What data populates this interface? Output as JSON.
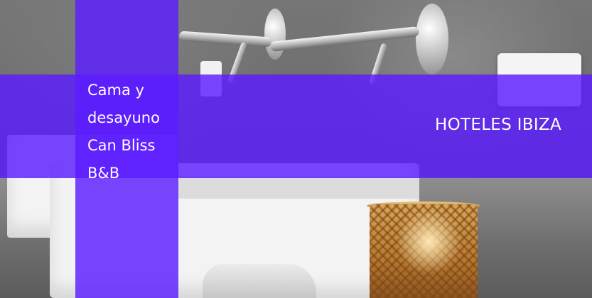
{
  "hotel": {
    "title": "Cama y desayuno Can Bliss B&B",
    "category_label": "HOTELES IBIZA"
  },
  "photo": {
    "subject_icons": [
      "wall-faucet-icon",
      "sink-icon",
      "lantern-icon",
      "towel-icon",
      "socket-icon"
    ]
  },
  "colors": {
    "overlay": "#5c1cff",
    "text": "#ffffff"
  }
}
